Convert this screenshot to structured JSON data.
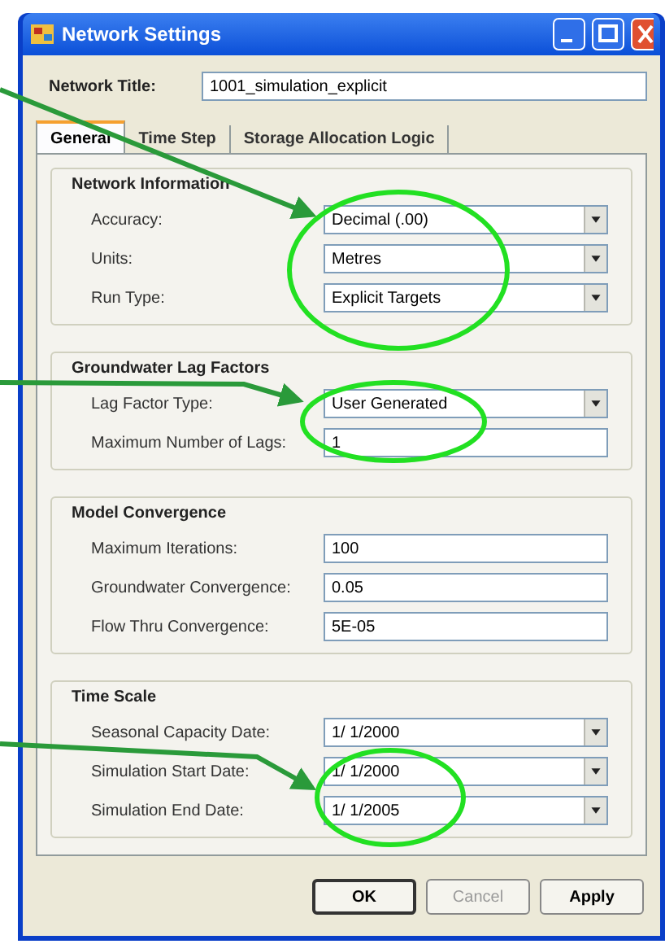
{
  "window": {
    "title": "Network Settings"
  },
  "network_title": {
    "label": "Network Title:",
    "value": "1001_simulation_explicit"
  },
  "tabs": [
    {
      "label": "General",
      "selected": true
    },
    {
      "label": "Time Step",
      "selected": false
    },
    {
      "label": "Storage Allocation Logic",
      "selected": false
    }
  ],
  "groups": [
    {
      "title": "Network Information",
      "rows": [
        {
          "kind": "dropdown",
          "label": "Accuracy:",
          "value": "Decimal (.00)"
        },
        {
          "kind": "dropdown",
          "label": "Units:",
          "value": "Metres"
        },
        {
          "kind": "dropdown",
          "label": "Run Type:",
          "value": "Explicit Targets"
        }
      ]
    },
    {
      "title": "Groundwater Lag Factors",
      "rows": [
        {
          "kind": "dropdown",
          "label": "Lag Factor Type:",
          "value": "User Generated"
        },
        {
          "kind": "text",
          "label": "Maximum Number of Lags:",
          "value": "1"
        }
      ]
    },
    {
      "title": "Model Convergence",
      "rows": [
        {
          "kind": "text",
          "label": "Maximum Iterations:",
          "value": "100"
        },
        {
          "kind": "text",
          "label": "Groundwater Convergence:",
          "value": "0.05"
        },
        {
          "kind": "text",
          "label": "Flow Thru Convergence:",
          "value": "5E-05"
        }
      ]
    },
    {
      "title": "Time Scale",
      "rows": [
        {
          "kind": "dropdown",
          "label": "Seasonal Capacity Date:",
          "value": "1/ 1/2000"
        },
        {
          "kind": "dropdown",
          "label": "Simulation Start Date:",
          "value": "1/ 1/2000"
        },
        {
          "kind": "dropdown",
          "label": "Simulation End Date:",
          "value": "1/ 1/2005"
        }
      ]
    }
  ],
  "buttons": [
    {
      "label": "OK",
      "disabled": false,
      "default": true
    },
    {
      "label": "Cancel",
      "disabled": true,
      "default": false
    },
    {
      "label": "Apply",
      "disabled": false,
      "default": false
    }
  ]
}
